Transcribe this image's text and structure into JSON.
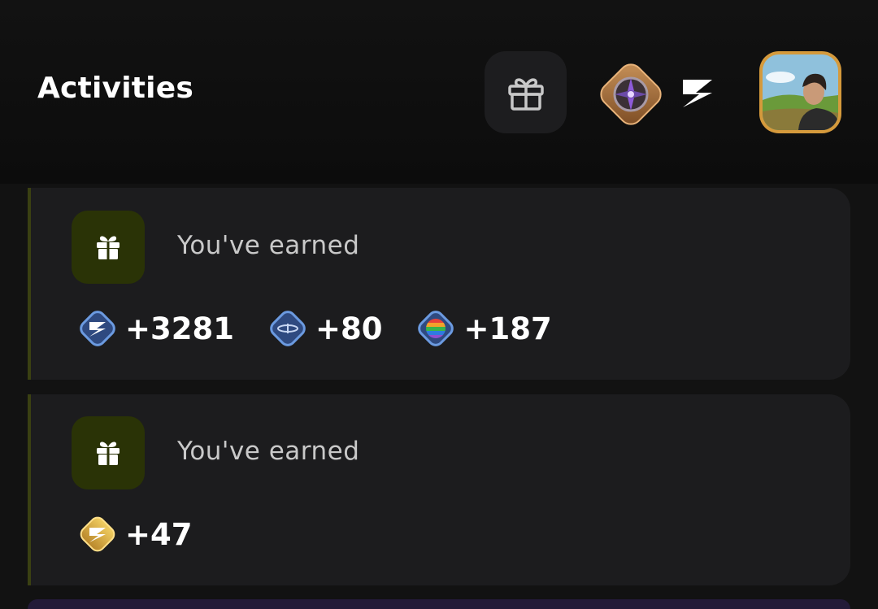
{
  "header": {
    "title": "Activities",
    "gift_icon": "gift-icon",
    "rank_badge_icon": "rank-badge-icon",
    "brand_icon": "bolt-logo-icon",
    "avatar": "user-avatar"
  },
  "activities": [
    {
      "label": "You've earned",
      "icon": "gift-icon",
      "rewards": [
        {
          "icon": "bolt-coin-icon",
          "value": "+3281"
        },
        {
          "icon": "orbit-token-icon",
          "value": "+80"
        },
        {
          "icon": "rainbow-token-icon",
          "value": "+187"
        }
      ]
    },
    {
      "label": "You've earned",
      "icon": "gift-icon",
      "rewards": [
        {
          "icon": "gold-bolt-coin-icon",
          "value": "+47"
        }
      ]
    }
  ],
  "colors": {
    "background": "#121212",
    "card": "#1c1c1e",
    "card_accent": "#3a4012",
    "gift_tile": "#2a3306",
    "avatar_border": "#d59a3c"
  }
}
